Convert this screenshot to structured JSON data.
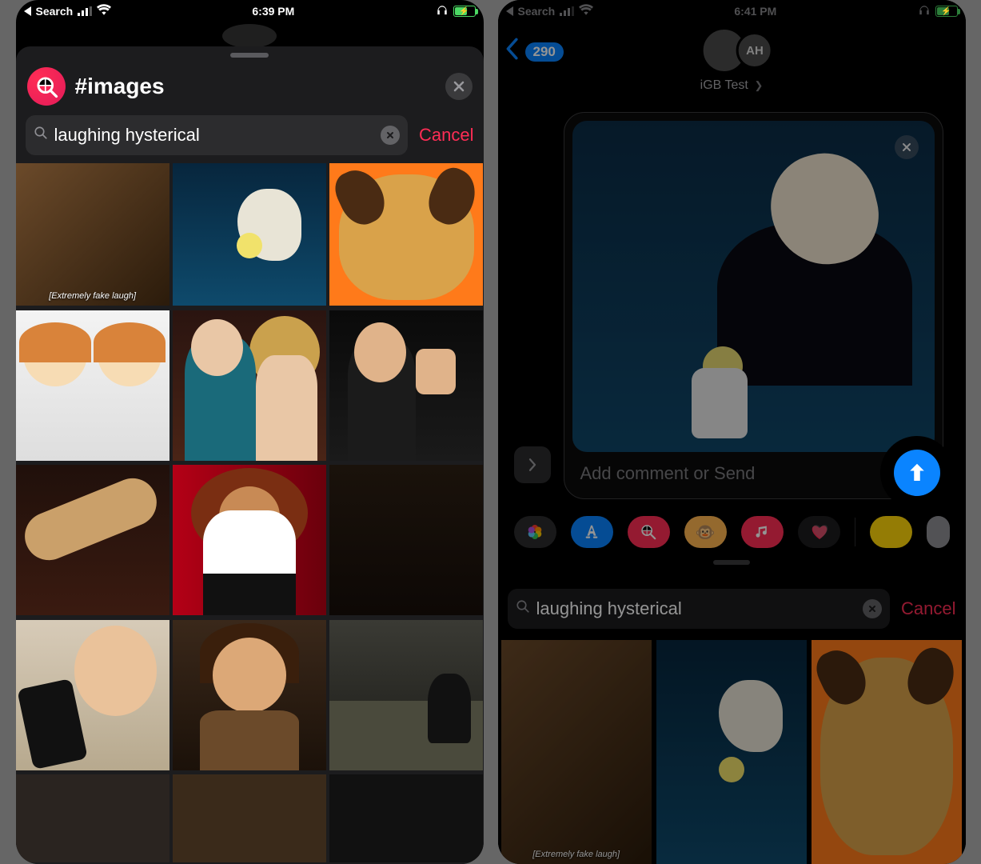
{
  "left": {
    "statusbar": {
      "back_app": "Search",
      "time": "6:39 PM"
    },
    "drawer": {
      "title": "#images",
      "search_value": "laughing hysterical",
      "cancel": "Cancel",
      "gifs": [
        {
          "caption": "[Extremely fake laugh]"
        },
        {},
        {},
        {},
        {},
        {},
        {},
        {},
        {},
        {},
        {},
        {},
        {},
        {},
        {}
      ]
    }
  },
  "right": {
    "statusbar": {
      "back_app": "Search",
      "time": "6:41 PM"
    },
    "nav": {
      "unread_badge": "290",
      "contact_name": "iGB Test",
      "avatar_initials": "AH"
    },
    "compose": {
      "placeholder": "Add comment or Send"
    },
    "lower": {
      "search_value": "laughing hysterical",
      "cancel": "Cancel",
      "captions": [
        "[Extremely fake laugh]",
        "",
        ""
      ]
    },
    "app_strip": [
      "photos-icon",
      "app-store-icon",
      "images-icon",
      "memoji-icon",
      "music-icon",
      "digital-touch-icon",
      "activity-icon",
      "more-icon"
    ]
  }
}
